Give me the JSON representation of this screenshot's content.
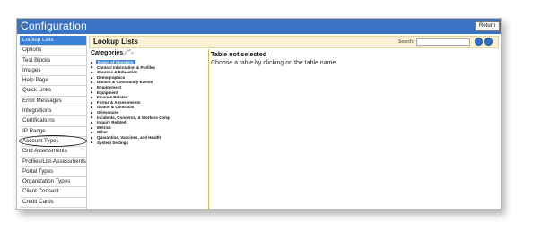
{
  "app": {
    "title": "Configuration",
    "return_label": "Return"
  },
  "sidebar": {
    "items": [
      {
        "label": "Lookup Lists",
        "active": true
      },
      {
        "label": "Options"
      },
      {
        "label": "Test Blocks"
      },
      {
        "label": "Images"
      },
      {
        "label": "Help Page"
      },
      {
        "label": "Quick Links"
      },
      {
        "label": "Error Messages"
      },
      {
        "label": "Integrations"
      },
      {
        "label": "Certifications"
      },
      {
        "label": "IP Range"
      },
      {
        "label": "Account Types"
      },
      {
        "label": "Grid Assessments"
      },
      {
        "label": "Profiles/List-Assessments"
      },
      {
        "label": "Portal Types"
      },
      {
        "label": "Organization Types"
      },
      {
        "label": "Client Consent"
      },
      {
        "label": "Credit Cards"
      }
    ]
  },
  "content": {
    "title": "Lookup Lists",
    "search_label": "Search:"
  },
  "categories": {
    "title": "Categories",
    "items": [
      {
        "label": "Board of Directors",
        "selected": true
      },
      {
        "label": "Contact Information & Profiles"
      },
      {
        "label": "Courses & Education"
      },
      {
        "label": "Demographics"
      },
      {
        "label": "Donors & Community Events"
      },
      {
        "label": "Employment"
      },
      {
        "label": "Equipment"
      },
      {
        "label": "Finance Related"
      },
      {
        "label": "Forms & Assessments"
      },
      {
        "label": "Grants & Contracts"
      },
      {
        "label": "Grievances"
      },
      {
        "label": "Incidents, Concerns, & Workers Comp"
      },
      {
        "label": "Inquiry Related"
      },
      {
        "label": "Metrics"
      },
      {
        "label": "Other"
      },
      {
        "label": "Quarantine, Vaccines, and Health"
      },
      {
        "label": "System Settings"
      }
    ]
  },
  "detail": {
    "title": "Table not selected",
    "message": "Choose a table by clicking on the table name"
  }
}
